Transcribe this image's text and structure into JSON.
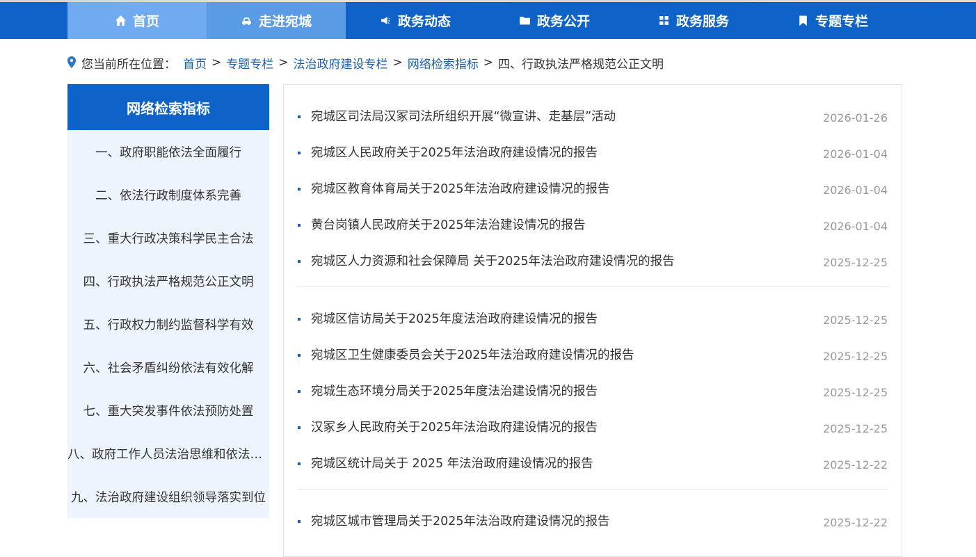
{
  "nav": {
    "items": [
      {
        "label": "首页",
        "icon": "home-icon"
      },
      {
        "label": "走进宛城",
        "icon": "car-icon"
      },
      {
        "label": "政务动态",
        "icon": "megaphone-icon"
      },
      {
        "label": "政务公开",
        "icon": "folder-icon"
      },
      {
        "label": "政务服务",
        "icon": "grid-icon"
      },
      {
        "label": "专题专栏",
        "icon": "bookmark-icon"
      }
    ]
  },
  "breadcrumb": {
    "prefix": "您当前所在位置：",
    "links": [
      "首页",
      "专题专栏",
      "法治政府建设专栏",
      "网络检索指标"
    ],
    "separator": ">",
    "current": "四、行政执法严格规范公正文明"
  },
  "sidebar": {
    "title": "网络检索指标",
    "items": [
      "一、政府职能依法全面履行",
      "二、依法行政制度体系完善",
      "三、重大行政决策科学民主合法",
      "四、行政执法严格规范公正文明",
      "五、行政权力制约监督科学有效",
      "六、社会矛盾纠纷依法有效化解",
      "七、重大突发事件依法预防处置",
      "八、政府工作人员法治思维和依法行政能力全面提高",
      "九、法治政府建设组织领导落实到位"
    ]
  },
  "articles": {
    "groups": [
      [
        {
          "title": "宛城区司法局汉冢司法所组织开展“微宣讲、走基层”活动",
          "date": "2026-01-26"
        },
        {
          "title": "宛城区人民政府关于2025年法治政府建设情况的报告",
          "date": "2026-01-04"
        },
        {
          "title": "宛城区教育体育局关于2025年法治政府建设情况的报告",
          "date": "2026-01-04"
        },
        {
          "title": "黄台岗镇人民政府关于2025年法治建设情况的报告",
          "date": "2026-01-04"
        },
        {
          "title": "宛城区人力资源和社会保障局 关于2025年法治政府建设情况的报告",
          "date": "2025-12-25"
        }
      ],
      [
        {
          "title": "宛城区信访局关于2025年度法治政府建设情况的报告",
          "date": "2025-12-25"
        },
        {
          "title": "宛城区卫生健康委员会关于2025年法治政府建设情况的报告",
          "date": "2025-12-25"
        },
        {
          "title": "宛城生态环境分局关于2025年度法治建设情况的报告",
          "date": "2025-12-25"
        },
        {
          "title": "汉冢乡人民政府关于2025年法治政府建设情况的报告",
          "date": "2025-12-25"
        },
        {
          "title": "宛城区统计局关于 2025 年法治政府建设情况的报告",
          "date": "2025-12-22"
        }
      ],
      [
        {
          "title": "宛城区城市管理局关于2025年法治政府建设情况的报告",
          "date": "2025-12-22"
        }
      ]
    ]
  },
  "colors": {
    "primary": "#0f63c8",
    "nav_home_bg": "#70aaf0",
    "nav_active_bg": "#5a9be6",
    "sidebar_bg": "#eef4fd",
    "link": "#1a5fb4",
    "date": "#999999"
  }
}
